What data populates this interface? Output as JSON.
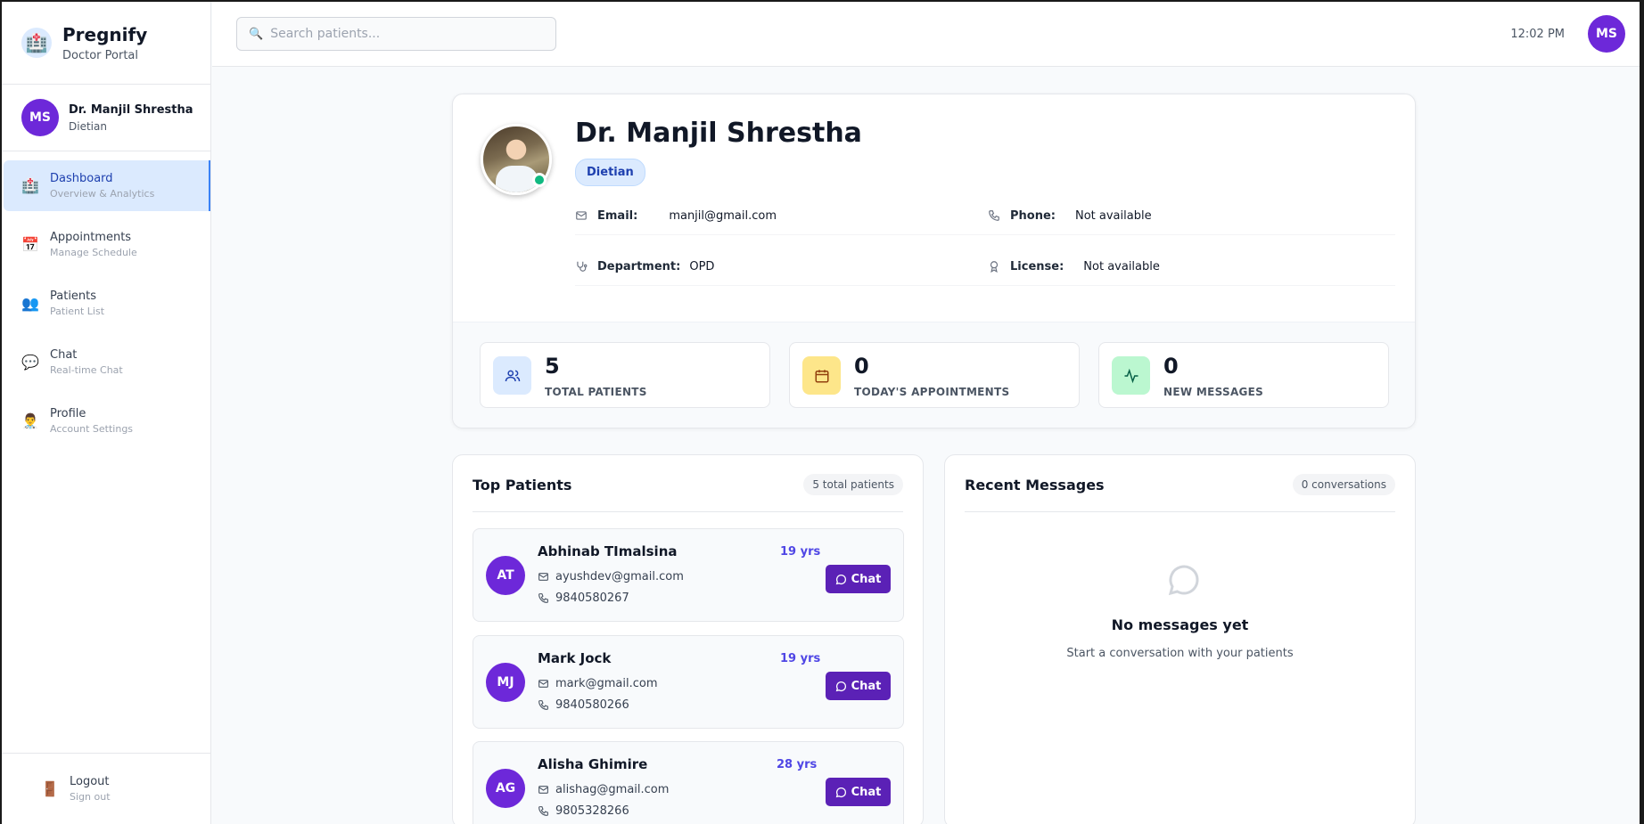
{
  "brand": {
    "name": "Pregnify",
    "subtitle": "Doctor Portal",
    "logo_icon": "hospital-icon"
  },
  "user": {
    "initials": "MS",
    "name": "Dr. Manjil Shrestha",
    "role": "Dietian"
  },
  "nav": [
    {
      "label": "Dashboard",
      "sub": "Overview & Analytics",
      "icon": "hospital-icon",
      "active": true
    },
    {
      "label": "Appointments",
      "sub": "Manage Schedule",
      "icon": "calendar-icon"
    },
    {
      "label": "Patients",
      "sub": "Patient List",
      "icon": "people-icon"
    },
    {
      "label": "Chat",
      "sub": "Real-time Chat",
      "icon": "speech-bubble-icon"
    },
    {
      "label": "Profile",
      "sub": "Account Settings",
      "icon": "doctor-icon"
    }
  ],
  "logout": {
    "label": "Logout",
    "sub": "Sign out"
  },
  "header": {
    "search_placeholder": "Search patients...",
    "time": "12:02 PM",
    "avatar_initials": "MS"
  },
  "profile": {
    "name": "Dr. Manjil Shrestha",
    "badge": "Dietian",
    "email_label": "Email:",
    "email": "manjil@gmail.com",
    "phone_label": "Phone:",
    "phone": "Not available",
    "department_label": "Department:",
    "department": "OPD",
    "license_label": "License:",
    "license": "Not available"
  },
  "stats": [
    {
      "value": "5",
      "label": "TOTAL PATIENTS",
      "color": "#dbeafe",
      "icon_color": "#1e40af"
    },
    {
      "value": "0",
      "label": "TODAY'S APPOINTMENTS",
      "color": "#fde68a",
      "icon_color": "#92400e"
    },
    {
      "value": "0",
      "label": "NEW MESSAGES",
      "color": "#bbf7d0",
      "icon_color": "#065f46"
    }
  ],
  "top_patients": {
    "title": "Top Patients",
    "count": "5 total patients",
    "chat_label": "Chat",
    "items": [
      {
        "initials": "AT",
        "name": "Abhinab TImalsina",
        "age": "19 yrs",
        "email": "ayushdev@gmail.com",
        "phone": "9840580267"
      },
      {
        "initials": "MJ",
        "name": "Mark Jock",
        "age": "19 yrs",
        "email": "mark@gmail.com",
        "phone": "9840580266"
      },
      {
        "initials": "AG",
        "name": "Alisha Ghimire",
        "age": "28 yrs",
        "email": "alishag@gmail.com",
        "phone": "9805328266"
      }
    ]
  },
  "recent_messages": {
    "title": "Recent Messages",
    "count": "0 conversations",
    "empty_title": "No messages yet",
    "empty_sub": "Start a conversation with your patients"
  },
  "colors": {
    "accent": "#5b21b6",
    "avatar": "#6d28d9",
    "active_nav": "#dbeafe",
    "online": "#10b981"
  }
}
